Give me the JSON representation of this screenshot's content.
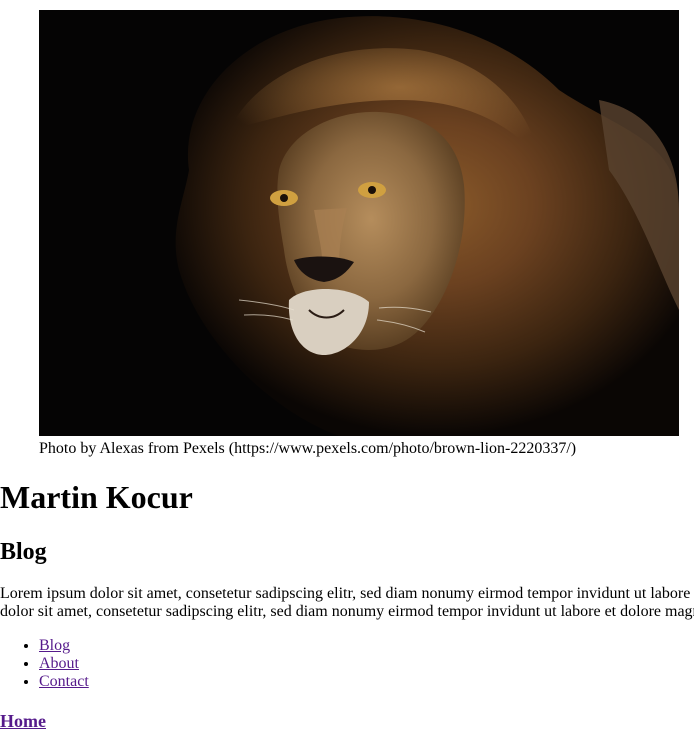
{
  "hero": {
    "image_alt": "brown lion",
    "caption": "Photo by Alexas from Pexels (https://www.pexels.com/photo/brown-lion-2220337/)"
  },
  "header": {
    "site_title": "Martin Kocur"
  },
  "main": {
    "heading": "Blog",
    "intro_line_1": "Lorem ipsum dolor sit amet, consetetur sadipscing elitr, sed diam nonumy eirmod tempor invidunt ut labore et dolore magna aliquyam erat, sed diam voluptua. At vero eos et accusam et justo duo dolores et ea rebum. Stet clita kasd gubergren, no sea takimata sanctus est Lorem ipsum",
    "intro_line_2": "dolor sit amet, consetetur sadipscing elitr, sed diam nonumy eirmod tempor invidunt ut labore et dolore magna aliquyam erat, sed diam voluptua."
  },
  "nav": {
    "items": [
      {
        "label": "Blog"
      },
      {
        "label": "About"
      },
      {
        "label": "Contact"
      }
    ]
  },
  "footer": {
    "home_link": "Home"
  },
  "colors": {
    "link_visited": "#551a8b",
    "text": "#000000",
    "background": "#ffffff"
  }
}
